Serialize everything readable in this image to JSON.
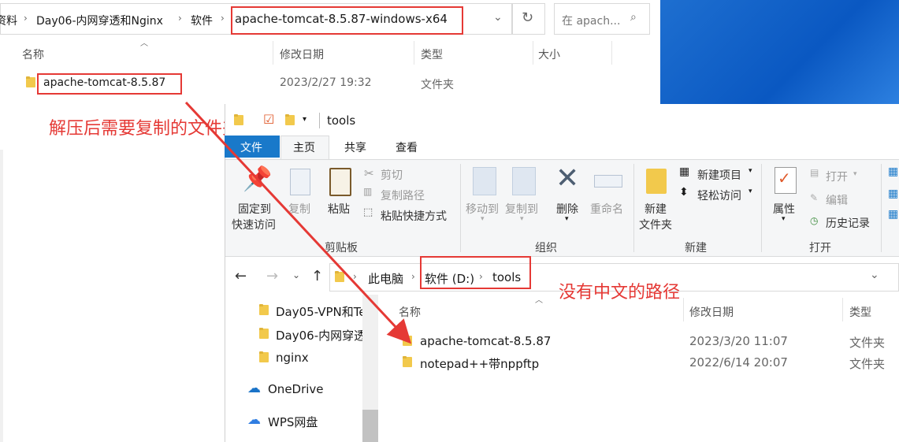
{
  "back_window": {
    "breadcrumb": {
      "prefix": "资料",
      "day06": "Day06-内网穿透和Nginx",
      "software": "软件",
      "current": "apache-tomcat-8.5.87-windows-x64"
    },
    "search_placeholder": "在 apach...",
    "columns": {
      "name": "名称",
      "modified": "修改日期",
      "type": "类型",
      "size": "大小"
    },
    "rows": [
      {
        "name": "apache-tomcat-8.5.87",
        "modified": "2023/2/27 19:32",
        "type": "文件夹"
      }
    ]
  },
  "annotations": {
    "copy_note": "解压后需要复制的文件夹",
    "path_note": "没有中文的路径",
    "color": "#e53935"
  },
  "front_window": {
    "title": "tools",
    "tabs": {
      "file": "文件",
      "home": "主页",
      "share": "共享",
      "view": "查看"
    },
    "ribbon": {
      "pin_l1": "固定到",
      "pin_l2": "快速访问",
      "copy": "复制",
      "paste": "粘贴",
      "cut": "剪切",
      "copy_path": "复制路径",
      "paste_shortcut": "粘贴快捷方式",
      "clipboard": "剪贴板",
      "move_to": "移动到",
      "copy_to": "复制到",
      "delete": "删除",
      "rename": "重命名",
      "organize": "组织",
      "new_folder_l1": "新建",
      "new_folder_l2": "文件夹",
      "new_item": "新建项目",
      "easy_access": "轻松访问",
      "new_group": "新建",
      "properties": "属性",
      "open": "打开",
      "edit": "编辑",
      "history": "历史记录",
      "open_group": "打开"
    },
    "address": {
      "pc": "此电脑",
      "drive": "软件 (D:)",
      "folder": "tools"
    },
    "nav_items": [
      "Day05-VPN和Te",
      "Day06-内网穿透",
      "nginx"
    ],
    "onedrive": "OneDrive",
    "wps": "WPS网盘",
    "columns": {
      "name": "名称",
      "modified": "修改日期",
      "type": "类型"
    },
    "rows": [
      {
        "name": "apache-tomcat-8.5.87",
        "modified": "2023/3/20 11:07",
        "type": "文件夹"
      },
      {
        "name": "notepad++带nppftp",
        "modified": "2022/6/14 20:07",
        "type": "文件夹"
      }
    ],
    "accent": "#1979ca"
  }
}
